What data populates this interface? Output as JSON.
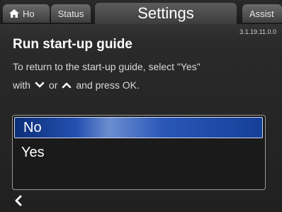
{
  "tabs": {
    "home": "Ho",
    "status": "Status",
    "settings": "Settings",
    "assist": "Assist"
  },
  "version": "3.1.19.11.0.0",
  "title": "Run start-up guide",
  "description": {
    "line1": "To return to the start-up guide, select \"Yes\"",
    "line2_prefix": "with",
    "line2_middle": "or",
    "line2_suffix": "and press OK."
  },
  "options": {
    "no": "No",
    "yes": "Yes",
    "selected": "No"
  },
  "icons": {
    "home": "home-icon",
    "down": "chevron-down-icon",
    "up": "chevron-up-icon",
    "back": "back-arrow-icon"
  },
  "colors": {
    "selection": "#2450b0"
  }
}
